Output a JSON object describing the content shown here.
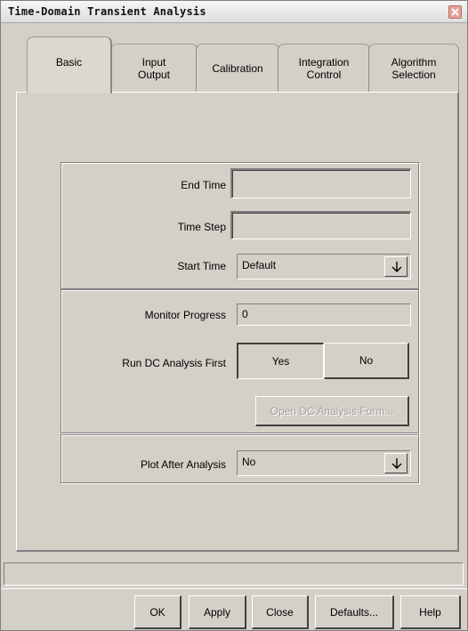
{
  "window": {
    "title": "Time-Domain Transient Analysis"
  },
  "tabs": [
    {
      "label": "Basic",
      "active": true
    },
    {
      "label": "Input\nOutput",
      "active": false
    },
    {
      "label": "Calibration",
      "active": false
    },
    {
      "label": "Integration\nControl",
      "active": false
    },
    {
      "label": "Algorithm\nSelection",
      "active": false
    }
  ],
  "form": {
    "end_time": {
      "label": "End Time",
      "value": ""
    },
    "time_step": {
      "label": "Time Step",
      "value": ""
    },
    "start_time": {
      "label": "Start Time",
      "value": "Default"
    },
    "monitor_progress": {
      "label": "Monitor Progress",
      "value": "0"
    },
    "run_dc_first": {
      "label": "Run DC Analysis First",
      "yes_label": "Yes",
      "no_label": "No",
      "selected": "Yes"
    },
    "open_dc_form": {
      "label": "Open DC Analysis Form...",
      "enabled": false
    },
    "plot_after": {
      "label": "Plot After Analysis",
      "value": "No"
    }
  },
  "buttons": {
    "ok": "OK",
    "apply": "Apply",
    "close": "Close",
    "defaults": "Defaults...",
    "help": "Help"
  },
  "icons": {
    "dropdown": "down-arrow-icon",
    "close": "close-icon"
  }
}
